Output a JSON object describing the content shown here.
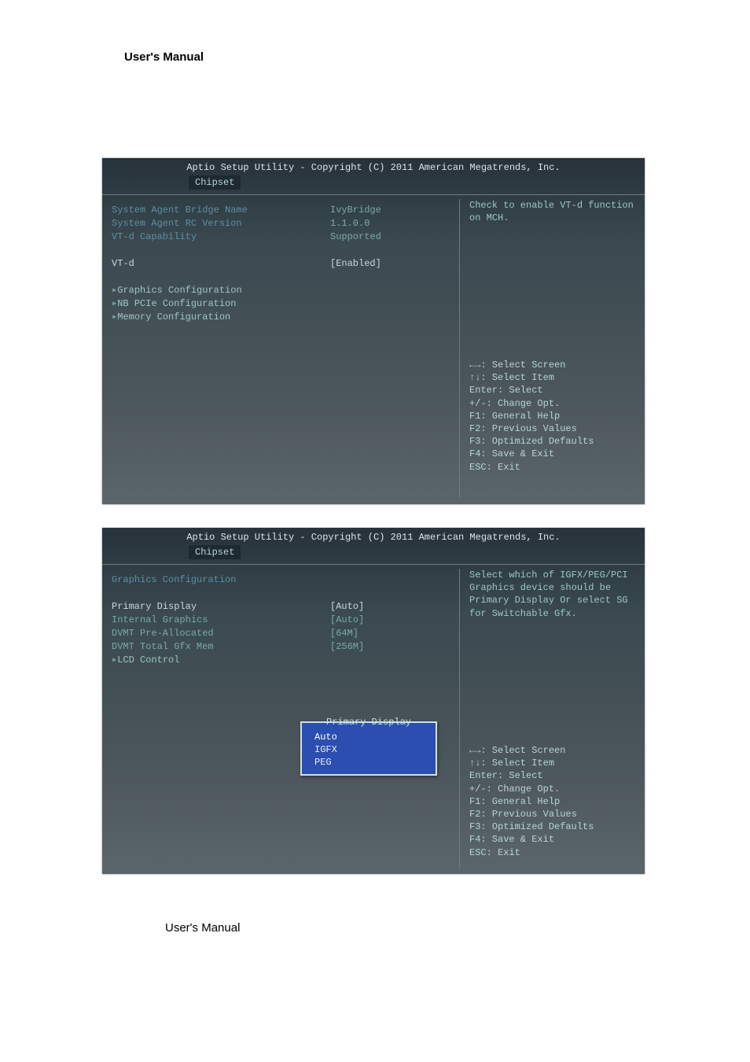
{
  "doc": {
    "header": "User's Manual",
    "footer": "User's Manual"
  },
  "bios_common": {
    "title": "Aptio Setup Utility - Copyright (C) 2011 American Megatrends, Inc.",
    "tab": "Chipset",
    "help": {
      "l1": "←→: Select Screen",
      "l2": "↑↓: Select Item",
      "l3": "Enter: Select",
      "l4": "+/-: Change Opt.",
      "l5": "F1: General Help",
      "l6": "F2: Previous Values",
      "l7": "F3: Optimized Defaults",
      "l8": "F4: Save & Exit",
      "l9": "ESC: Exit"
    }
  },
  "shot1": {
    "rows": {
      "r1_label": "System Agent Bridge Name",
      "r1_value": "IvyBridge",
      "r2_label": "System Agent RC Version",
      "r2_value": "1.1.0.0",
      "r3_label": "VT-d Capability",
      "r3_value": "Supported",
      "r4_label": "VT-d",
      "r4_value": "[Enabled]",
      "s1": "Graphics Configuration",
      "s2": "NB PCIe Configuration",
      "s3": "Memory Configuration"
    },
    "right_desc_l1": "Check to enable VT-d function",
    "right_desc_l2": "on MCH."
  },
  "shot2": {
    "heading": "Graphics Configuration",
    "rows": {
      "r1_label": "Primary Display",
      "r1_value": "[Auto]",
      "r2_label": "Internal Graphics",
      "r2_value": "[Auto]",
      "r3_label": "DVMT Pre-Allocated",
      "r3_value": "[64M]",
      "r4_label": "DVMT Total Gfx Mem",
      "r4_value": "[256M]",
      "s1": "LCD Control"
    },
    "right_desc_l1": "Select which of IGFX/PEG/PCI",
    "right_desc_l2": "Graphics device should be",
    "right_desc_l3": "Primary Display Or select SG",
    "right_desc_l4": "for Switchable Gfx.",
    "popup": {
      "title": "Primary Display",
      "o1": "Auto",
      "o2": "IGFX",
      "o3": "PEG"
    }
  }
}
